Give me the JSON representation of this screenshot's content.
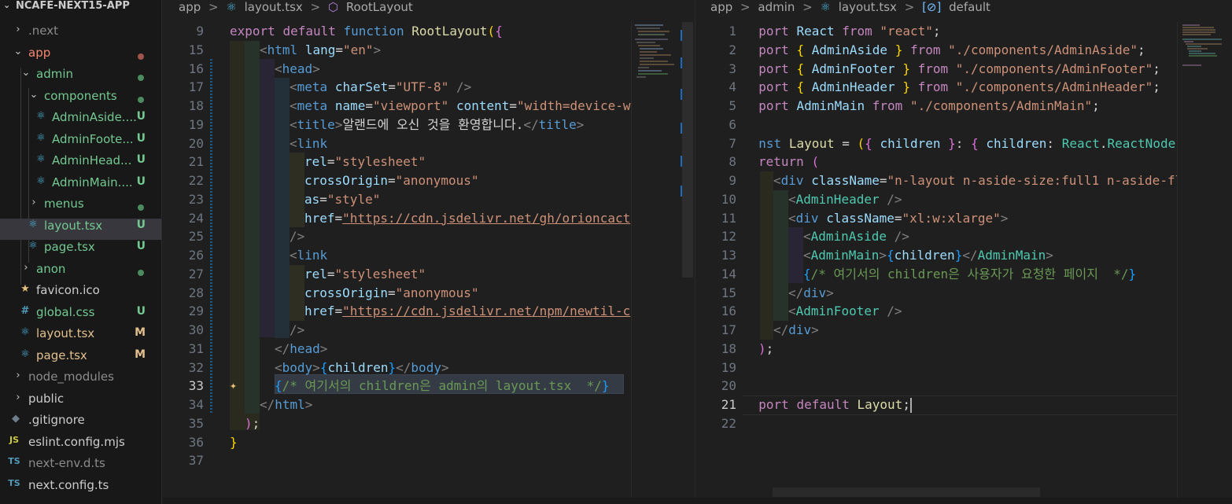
{
  "explorer": {
    "title": "NCAFE-NEXT15-APP",
    "items": [
      {
        "label": ".next",
        "badge": ""
      },
      {
        "label": "app",
        "badge": ""
      },
      {
        "label": "admin",
        "badge": ""
      },
      {
        "label": "components",
        "badge": ""
      },
      {
        "label": "AdminAside....",
        "badge": "U"
      },
      {
        "label": "AdminFoote...",
        "badge": "U"
      },
      {
        "label": "AdminHead...",
        "badge": "U"
      },
      {
        "label": "AdminMain....",
        "badge": "U"
      },
      {
        "label": "menus",
        "badge": ""
      },
      {
        "label": "layout.tsx",
        "badge": "U"
      },
      {
        "label": "page.tsx",
        "badge": "U"
      },
      {
        "label": "anon",
        "badge": ""
      },
      {
        "label": "favicon.ico",
        "badge": ""
      },
      {
        "label": "global.css",
        "badge": "U"
      },
      {
        "label": "layout.tsx",
        "badge": "M"
      },
      {
        "label": "page.tsx",
        "badge": "M"
      },
      {
        "label": "node_modules",
        "badge": ""
      },
      {
        "label": "public",
        "badge": ""
      },
      {
        "label": ".gitignore",
        "badge": ""
      },
      {
        "label": "eslint.config.mjs",
        "badge": ""
      },
      {
        "label": "next-env.d.ts",
        "badge": ""
      },
      {
        "label": "next.config.ts",
        "badge": ""
      }
    ],
    "icons": {
      "js": "JS",
      "ts": "TS",
      "css": "#"
    }
  },
  "left_editor": {
    "breadcrumb": [
      "app",
      ">",
      "layout.tsx",
      ">",
      "RootLayout"
    ],
    "line_numbers": [
      "9",
      "15",
      "16",
      "17",
      "18",
      "19",
      "20",
      "21",
      "22",
      "23",
      "24",
      "25",
      "26",
      "27",
      "28",
      "29",
      "30",
      "31",
      "32",
      "33",
      "34",
      "35",
      "36",
      "37"
    ],
    "sticky_line": {
      "kw1": "export",
      "kw2": "default",
      "kw3": "function",
      "name": "RootLayout",
      "paren": "(",
      "brace": "{"
    },
    "strings": {
      "lang": "\"en\"",
      "charset": "\"UTF-8\"",
      "viewport": "\"viewport\"",
      "content": "\"width=device-w",
      "title_text": "알랜드에 오신 것을 환영합니다.",
      "stylesheet": "\"stylesheet\"",
      "anonymous": "\"anonymous\"",
      "style": "\"style\"",
      "href1": "\"https://cdn.jsdelivr.net/gh/orioncact",
      "href2": "\"https://cdn.jsdelivr.net/npm/newtil-c",
      "comment": "/* 여기서의 children은 admin의 layout.tsx  */"
    }
  },
  "right_editor": {
    "breadcrumb": [
      "app",
      ">",
      "admin",
      ">",
      "layout.tsx",
      ">",
      "default"
    ],
    "line_numbers": [
      "1",
      "2",
      "3",
      "4",
      "5",
      "6",
      "7",
      "8",
      "9",
      "10",
      "11",
      "12",
      "13",
      "14",
      "15",
      "16",
      "17",
      "18",
      "19",
      "20",
      "21",
      "22"
    ],
    "strings": {
      "react": "\"react\"",
      "aside_path": "\"./components/AdminAside\"",
      "footer_path": "\"./components/AdminFooter\"",
      "header_path": "\"./components/AdminHeader\"",
      "main_path": "\"./components/AdminMain\"",
      "classname1": "\"n-layout n-aside-size:full1 n-aside-fl",
      "classname2": "\"xl:w:xlarge\"",
      "comment": "/* 여기서의 children은 사용자가 요청한 페이지  */"
    }
  }
}
